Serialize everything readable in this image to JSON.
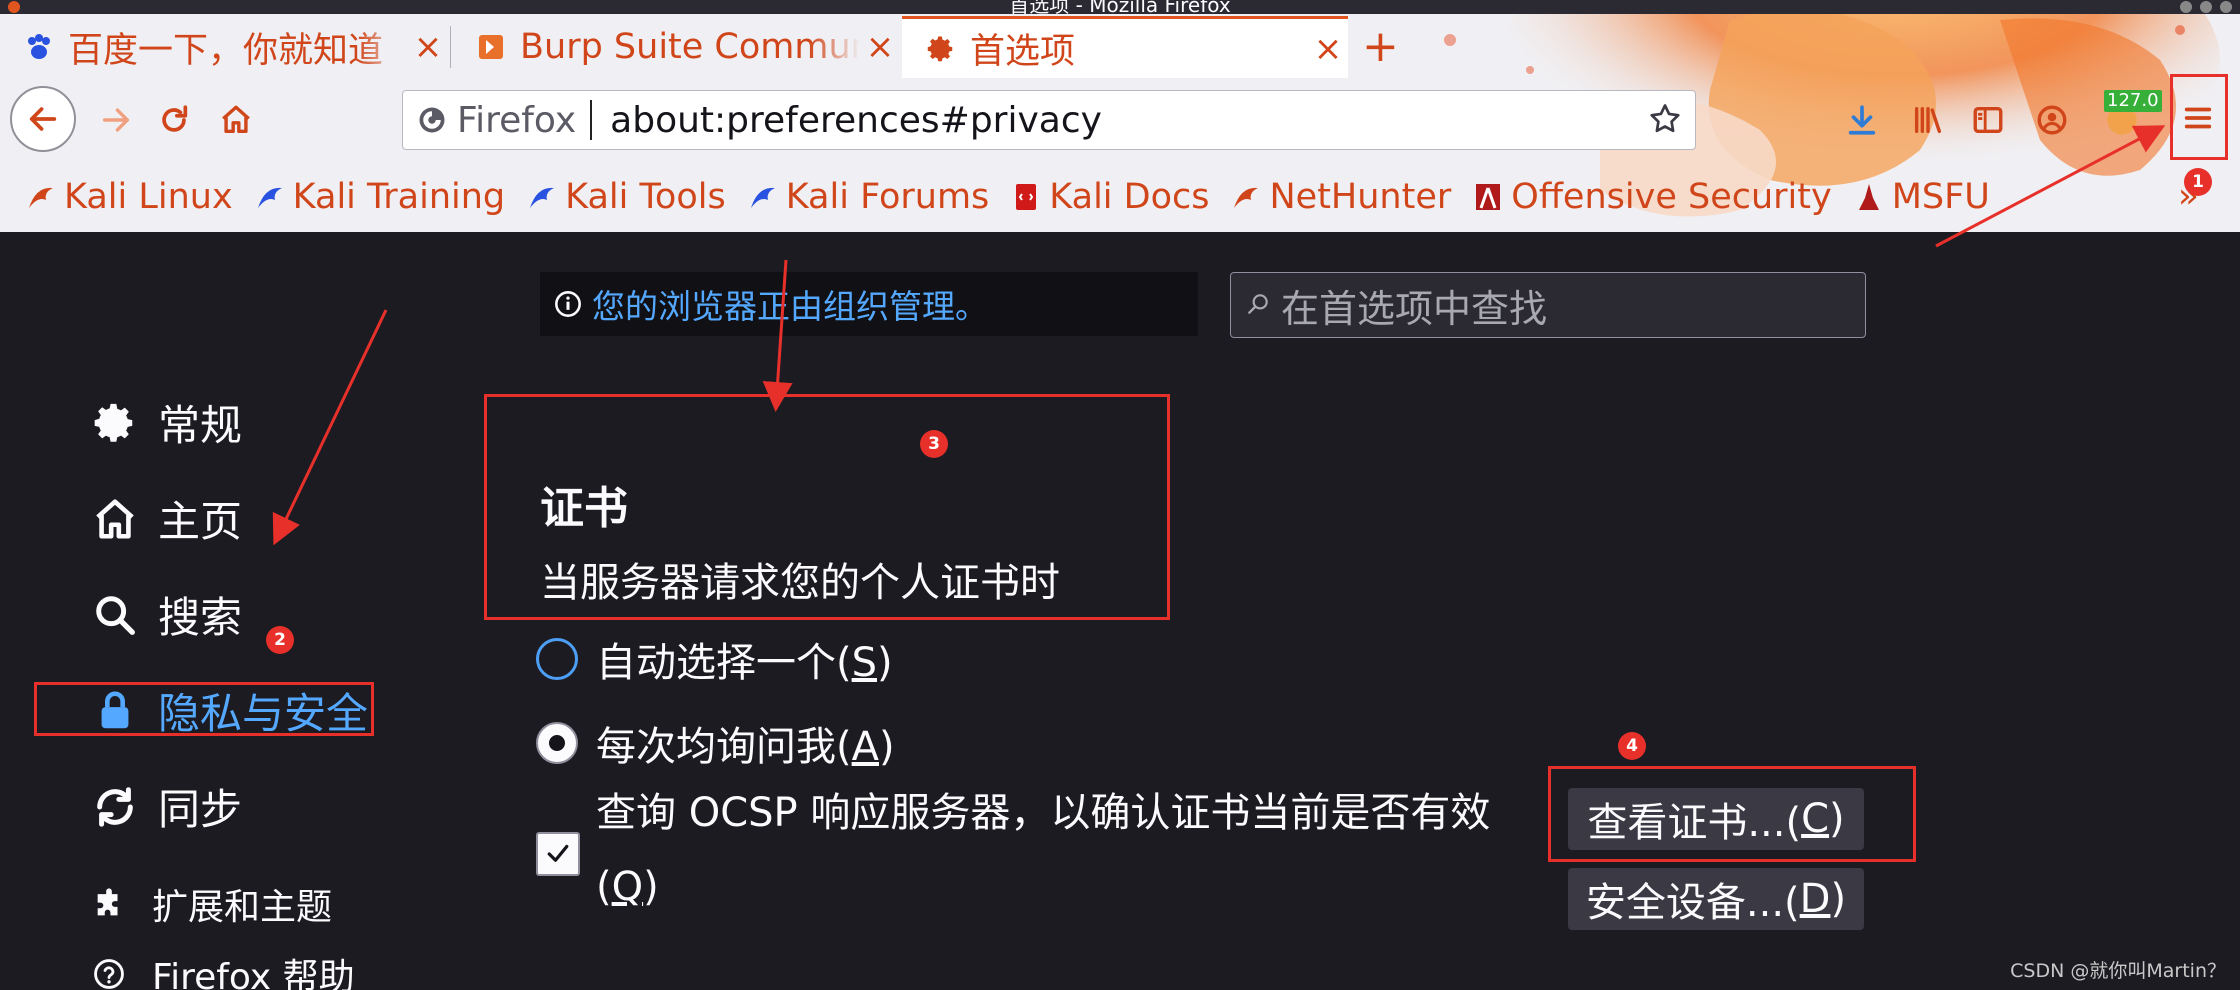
{
  "window": {
    "title": "首选项 - Mozilla Firefox"
  },
  "tabs": [
    {
      "label": "百度一下，你就知道",
      "icon": "baidu-icon",
      "active": false
    },
    {
      "label": "Burp Suite Community",
      "icon": "burp-icon",
      "active": false
    },
    {
      "label": "首选项",
      "icon": "gear-icon",
      "active": true
    }
  ],
  "tab_close_glyph": "×",
  "new_tab_glyph": "+",
  "urlbar": {
    "identity_label": "Firefox",
    "url": "about:preferences#privacy"
  },
  "toolbar": {
    "extension_badge": "127.0"
  },
  "bookmarks": [
    {
      "label": "Kali Linux",
      "icon": "kali-icon"
    },
    {
      "label": "Kali Training",
      "icon": "kali-icon"
    },
    {
      "label": "Kali Tools",
      "icon": "kali-icon"
    },
    {
      "label": "Kali Forums",
      "icon": "kali-icon"
    },
    {
      "label": "Kali Docs",
      "icon": "kali-docs-icon"
    },
    {
      "label": "NetHunter",
      "icon": "kali-icon"
    },
    {
      "label": "Offensive Security",
      "icon": "offsec-icon"
    },
    {
      "label": "MSFU",
      "icon": "msfu-icon"
    }
  ],
  "bookmark_overflow": "»",
  "sidebar": {
    "items": [
      {
        "label": "常规",
        "icon": "gear-icon"
      },
      {
        "label": "主页",
        "icon": "home-icon"
      },
      {
        "label": "搜索",
        "icon": "search-icon"
      },
      {
        "label": "隐私与安全",
        "icon": "lock-icon",
        "selected": true
      },
      {
        "label": "同步",
        "icon": "sync-icon"
      },
      {
        "label": "扩展和主题",
        "icon": "puzzle-icon"
      },
      {
        "label": "Firefox 帮助",
        "icon": "help-icon"
      }
    ]
  },
  "managed_notice": "您的浏览器正由组织管理。",
  "search": {
    "placeholder": "在首选项中查找"
  },
  "certificates": {
    "title": "证书",
    "description": "当服务器请求您的个人证书时",
    "radio_auto": {
      "label": "自动选择一个(",
      "key": "S",
      "suffix": ")"
    },
    "radio_ask": {
      "label": "每次均询问我(",
      "key": "A",
      "suffix": ")"
    },
    "ocsp": {
      "label": "查询 OCSP 响应服务器，以确认证书当前是否有效",
      "label_line2_prefix": "(",
      "key": "Q",
      "suffix": ")",
      "checked": true
    },
    "view_button": {
      "label": "查看证书...(",
      "key": "C",
      "suffix": ")"
    },
    "devices_button": {
      "label": "安全设备...(",
      "key": "D",
      "suffix": ")"
    }
  },
  "annotations": {
    "badges": [
      "1",
      "2",
      "3",
      "4"
    ],
    "color": "#e8302a"
  },
  "watermark": "CSDN @就你叫Martin？",
  "colors": {
    "accent": "#54a8ff",
    "tab_text": "#d0461a",
    "content_bg": "#1c1b22"
  }
}
